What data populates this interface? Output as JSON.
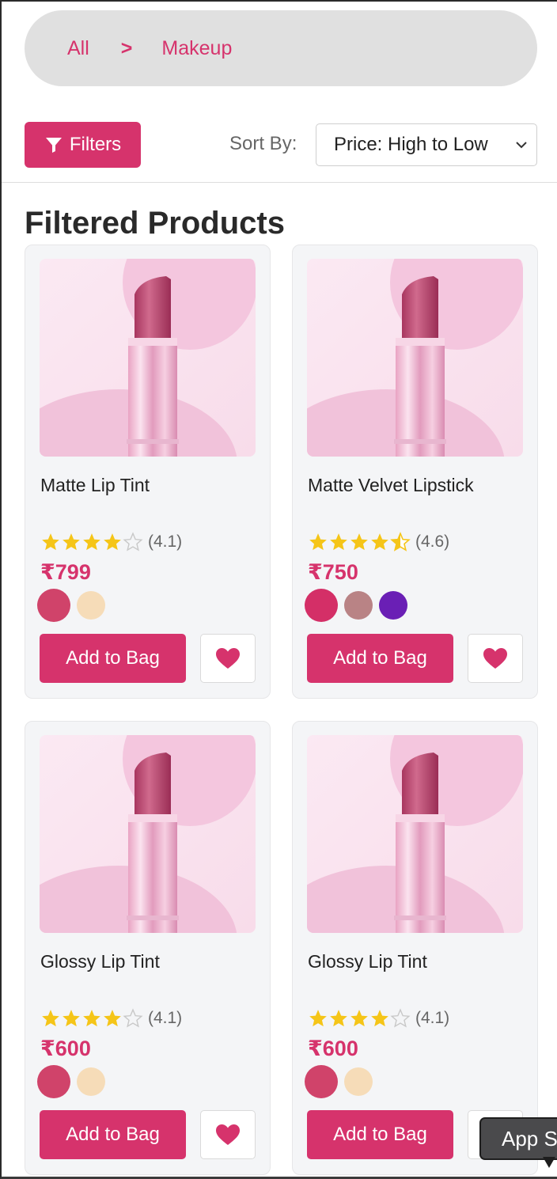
{
  "breadcrumb": {
    "items": [
      "All",
      "Makeup"
    ],
    "separator": ">"
  },
  "toolbar": {
    "filters_label": "Filters",
    "sort_label": "Sort By:",
    "sort_value": "Price: High to Low"
  },
  "section_title": "Filtered Products",
  "products": [
    {
      "name": "Matte Lip Tint",
      "rating": 4.1,
      "rating_text": "(4.1)",
      "price": "₹799",
      "swatches": [
        "#d0436a",
        "#f6dcb8"
      ],
      "add_label": "Add to Bag"
    },
    {
      "name": "Matte Velvet Lipstick",
      "rating": 4.6,
      "rating_text": "(4.6)",
      "price": "₹750",
      "swatches": [
        "#d42f67",
        "#b98385",
        "#6a1fb5"
      ],
      "add_label": "Add to Bag"
    },
    {
      "name": "Glossy Lip Tint",
      "rating": 4.1,
      "rating_text": "(4.1)",
      "price": "₹600",
      "swatches": [
        "#d0436a",
        "#f6dcb8"
      ],
      "add_label": "Add to Bag"
    },
    {
      "name": "Glossy Lip Tint",
      "rating": 4.1,
      "rating_text": "(4.1)",
      "price": "₹600",
      "swatches": [
        "#d0436a",
        "#f6dcb8"
      ],
      "add_label": "Add to Bag"
    }
  ],
  "tooltip": {
    "text": "App S"
  },
  "colors": {
    "accent": "#d6336c",
    "star": "#f5c518",
    "card_bg": "#f4f5f7"
  }
}
